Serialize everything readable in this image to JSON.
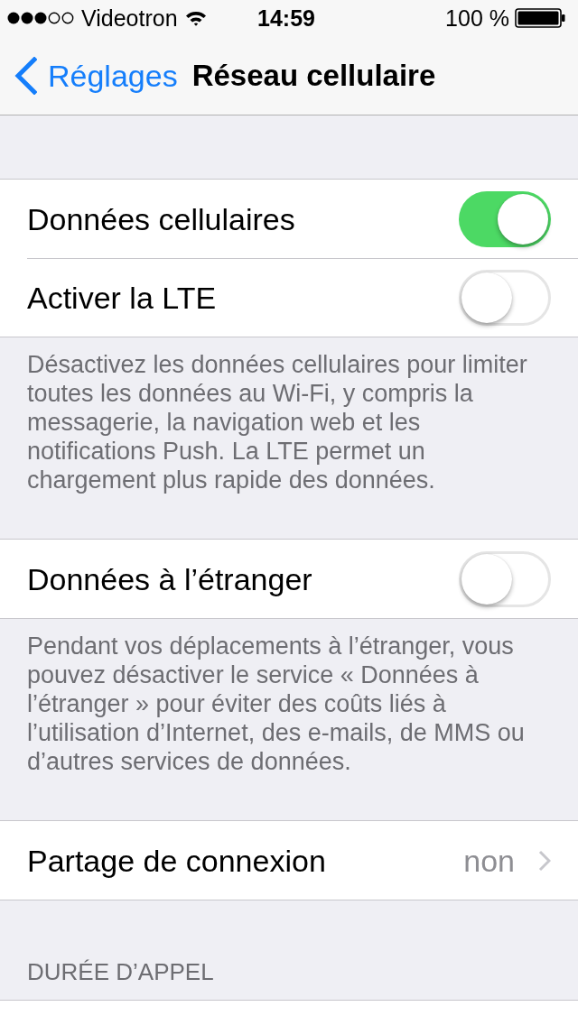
{
  "status_bar": {
    "carrier": "Videotron",
    "time": "14:59",
    "battery": "100 %"
  },
  "nav": {
    "back": "Réglages",
    "title": "Réseau cellulaire"
  },
  "sections": [
    {
      "rows": [
        {
          "kind": "switch",
          "label": "Données cellulaires",
          "on": true
        },
        {
          "kind": "switch",
          "label": "Activer la LTE",
          "on": false
        }
      ],
      "footer": "Désactivez les données cellulaires pour limiter toutes les données au Wi-Fi, y compris la messagerie, la navigation web et les notifications Push. La LTE permet un chargement plus rapide des données."
    },
    {
      "rows": [
        {
          "kind": "switch",
          "label": "Données à l’étranger",
          "on": false
        }
      ],
      "footer": "Pendant vos déplacements à l’étranger, vous pouvez désactiver le service « Données à l’étranger » pour éviter des coûts liés à l’utilisation d’Internet, des e-mails, de MMS ou d’autres services de données."
    },
    {
      "rows": [
        {
          "kind": "link",
          "label": "Partage de connexion",
          "value": "non"
        }
      ]
    },
    {
      "header": "DURÉE D’APPEL"
    }
  ]
}
